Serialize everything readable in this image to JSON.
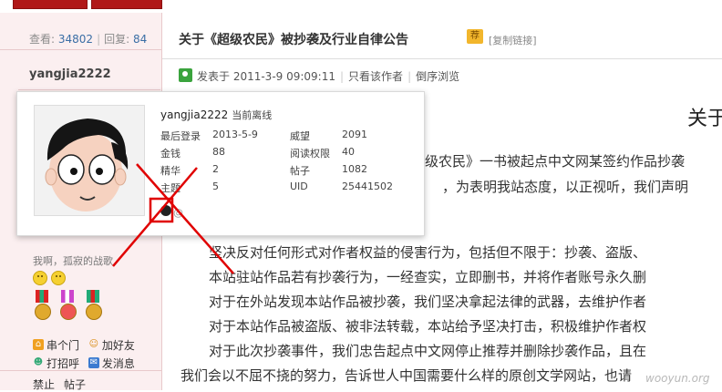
{
  "sidebar": {
    "stats": {
      "views_label": "查看:",
      "views": "34802",
      "replies_label": "回复:",
      "replies": "84"
    },
    "username": "yangjia2222",
    "signature": "我啊，孤寂的战歌",
    "actions": [
      {
        "label": "串个门",
        "icon": "home-icon"
      },
      {
        "label": "加好友",
        "icon": "add-friend-icon"
      },
      {
        "label": "打招呼",
        "icon": "greet-icon"
      },
      {
        "label": "发消息",
        "icon": "message-icon"
      }
    ],
    "bottom_links": [
      "禁止",
      "帖子"
    ]
  },
  "thread": {
    "title": "关于《超级农民》被抄袭及行业自律公告",
    "copy_link": "[复制链接]",
    "meta": {
      "posted": "发表于 2011-3-9 09:09:11",
      "only_author": "只看该作者",
      "reverse": "倒序浏览"
    }
  },
  "post": {
    "heading": "关于",
    "lines": [
      "级农民》一书被起点中文网某签约作品抄袭",
      "，为表明我站态度，以正视听，我们声明",
      "坚决反对任何形式对作者权益的侵害行为，包括但不限于：抄袭、盗版、",
      "本站驻站作品若有抄袭行为，一经查实，立即删书，并将作者账号永久删",
      "对于在外站发现本站作品被抄袭，我们坚决拿起法律的武器，去维护作者",
      "对于本站作品被盗版、被非法转载，本站给予坚决打击，积极维护作者权",
      "对于此次抄袭事件，我们忠告起点中文网停止推荐并删除抄袭作品，且在",
      "我们会以不屈不挠的努力，告诉世人中国需要什么样的原创文学网站，也请"
    ]
  },
  "popup": {
    "username": "yangjia2222",
    "status": "当前离线",
    "fields": [
      {
        "k1": "最后登录",
        "v1": "2013-5-9",
        "k2": "威望",
        "v2": "2091"
      },
      {
        "k1": "金钱",
        "v1": "88",
        "k2": "阅读权限",
        "v2": "40"
      },
      {
        "k1": "精华",
        "v1": "2",
        "k2": "帖子",
        "v2": "1082"
      },
      {
        "k1": "主题",
        "v1": "5",
        "k2": "UID",
        "v2": "25441502"
      }
    ],
    "badge_text": "@"
  },
  "watermark": "wooyun.org",
  "colors": {
    "accent_red": "#b01818",
    "sidebar_bg": "#fbeff0",
    "annotation_red": "#e00000"
  }
}
